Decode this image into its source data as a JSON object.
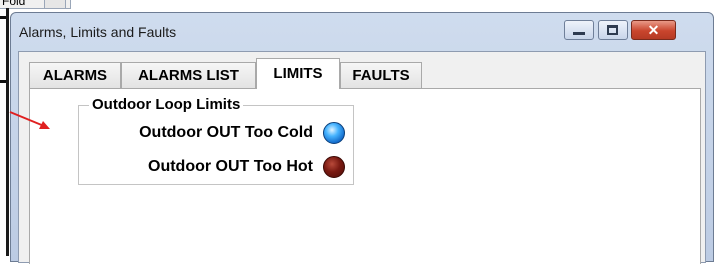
{
  "background": {
    "fragment_text": "Fold"
  },
  "window": {
    "title": "Alarms, Limits and Faults",
    "controls": {
      "close_glyph": "✕"
    }
  },
  "tabs": [
    {
      "label": "ALARMS",
      "active": false
    },
    {
      "label": "ALARMS LIST",
      "active": false
    },
    {
      "label": "LIMITS",
      "active": true
    },
    {
      "label": "FAULTS",
      "active": false
    }
  ],
  "limits_panel": {
    "group_title": "Outdoor Loop Limits",
    "indicators": [
      {
        "label": "Outdoor OUT Too Cold",
        "state_color": "#1e88e5",
        "icon": "blue-indicator-light"
      },
      {
        "label": "Outdoor OUT Too Hot",
        "state_color": "#7a1a12",
        "icon": "red-indicator-light"
      }
    ]
  },
  "annotation": {
    "arrow_color": "#e02020"
  }
}
